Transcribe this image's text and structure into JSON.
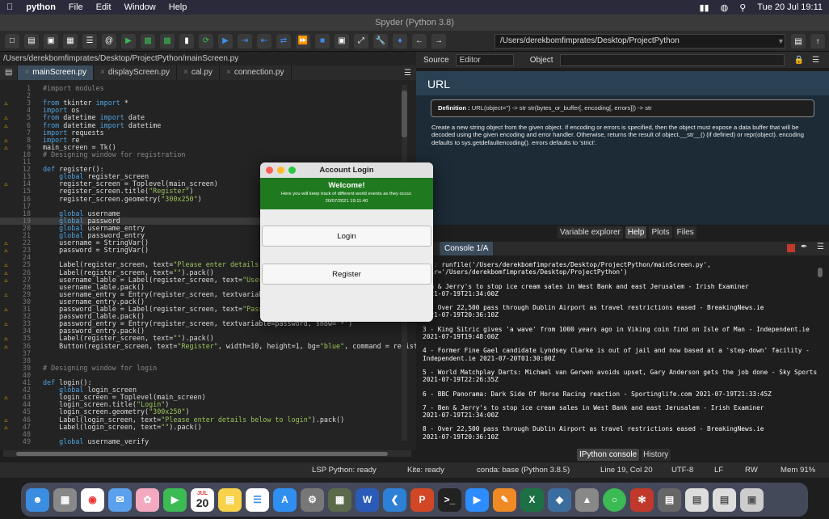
{
  "menubar": {
    "app": "python",
    "items": [
      "File",
      "Edit",
      "Window",
      "Help"
    ],
    "clock": "Tue 20 Jul  19:11"
  },
  "window": {
    "title": "Spyder (Python 3.8)"
  },
  "toolbar": {
    "path": "/Users/derekbomfimprates/Desktop/ProjectPython"
  },
  "editor": {
    "filepath": "/Users/derekbomfimprates/Desktop/ProjectPython/mainScreen.py",
    "tabs": [
      "mainScreen.py",
      "displayScreen.py",
      "cal.py",
      "connection.py"
    ],
    "lines": [
      {
        "n": "1",
        "w": false,
        "t": "#import modules",
        "c": "cm"
      },
      {
        "n": "2",
        "w": false,
        "t": ""
      },
      {
        "n": "3",
        "w": true,
        "t": "from tkinter import *"
      },
      {
        "n": "4",
        "w": false,
        "t": "import os"
      },
      {
        "n": "5",
        "w": true,
        "t": "from datetime import date"
      },
      {
        "n": "6",
        "w": true,
        "t": "from datetime import datetime"
      },
      {
        "n": "7",
        "w": false,
        "t": "import requests"
      },
      {
        "n": "8",
        "w": true,
        "t": "import re"
      },
      {
        "n": "9",
        "w": true,
        "t": "main_screen = Tk()"
      },
      {
        "n": "10",
        "w": false,
        "t": "# Designing window for registration",
        "c": "cm"
      },
      {
        "n": "11",
        "w": false,
        "t": ""
      },
      {
        "n": "12",
        "w": false,
        "t": "def register():"
      },
      {
        "n": "13",
        "w": false,
        "t": "    global register_screen"
      },
      {
        "n": "14",
        "w": true,
        "t": "    register_screen = Toplevel(main_screen)"
      },
      {
        "n": "15",
        "w": false,
        "t": "    register_screen.title(\"Register\")"
      },
      {
        "n": "16",
        "w": false,
        "t": "    register_screen.geometry(\"300x250\")"
      },
      {
        "n": "17",
        "w": false,
        "t": ""
      },
      {
        "n": "18",
        "w": false,
        "t": "    global username"
      },
      {
        "n": "19",
        "w": false,
        "t": "    global password",
        "cur": true
      },
      {
        "n": "20",
        "w": false,
        "t": "    global username_entry"
      },
      {
        "n": "21",
        "w": false,
        "t": "    global password_entry"
      },
      {
        "n": "22",
        "w": true,
        "t": "    username = StringVar()"
      },
      {
        "n": "23",
        "w": true,
        "t": "    password = StringVar()"
      },
      {
        "n": "24",
        "w": false,
        "t": ""
      },
      {
        "n": "25",
        "w": true,
        "t": "    Label(register_screen, text=\"Please enter details bel"
      },
      {
        "n": "26",
        "w": true,
        "t": "    Label(register_screen, text=\"\").pack()"
      },
      {
        "n": "27",
        "w": true,
        "t": "    username_lable = Label(register_screen, text=\"Usernam"
      },
      {
        "n": "28",
        "w": false,
        "t": "    username_lable.pack()"
      },
      {
        "n": "29",
        "w": true,
        "t": "    username_entry = Entry(register_screen, textvariable="
      },
      {
        "n": "30",
        "w": false,
        "t": "    username_entry.pack()"
      },
      {
        "n": "31",
        "w": true,
        "t": "    password_lable = Label(register_screen, text=\"Passwor"
      },
      {
        "n": "32",
        "w": false,
        "t": "    password_lable.pack()"
      },
      {
        "n": "33",
        "w": true,
        "t": "    password_entry = Entry(register_screen, textvariable=password, show='*')"
      },
      {
        "n": "34",
        "w": false,
        "t": "    password_entry.pack()"
      },
      {
        "n": "35",
        "w": true,
        "t": "    Label(register_screen, text=\"\").pack()"
      },
      {
        "n": "36",
        "w": true,
        "t": "    Button(register_screen, text=\"Register\", width=10, height=1, bg=\"blue\", command = registe"
      },
      {
        "n": "37",
        "w": false,
        "t": ""
      },
      {
        "n": "38",
        "w": false,
        "t": ""
      },
      {
        "n": "39",
        "w": false,
        "t": "# Designing window for login",
        "c": "cm"
      },
      {
        "n": "40",
        "w": false,
        "t": ""
      },
      {
        "n": "41",
        "w": false,
        "t": "def login():"
      },
      {
        "n": "42",
        "w": false,
        "t": "    global login_screen"
      },
      {
        "n": "43",
        "w": true,
        "t": "    login_screen = Toplevel(main_screen)"
      },
      {
        "n": "44",
        "w": false,
        "t": "    login_screen.title(\"Login\")"
      },
      {
        "n": "45",
        "w": false,
        "t": "    login_screen.geometry(\"300x250\")"
      },
      {
        "n": "46",
        "w": true,
        "t": "    Label(login_screen, text=\"Please enter details below to login\").pack()"
      },
      {
        "n": "47",
        "w": true,
        "t": "    Label(login_screen, text=\"\").pack()"
      },
      {
        "n": "48",
        "w": false,
        "t": ""
      },
      {
        "n": "49",
        "w": false,
        "t": "    global username_verify"
      }
    ]
  },
  "right_panel": {
    "source_label": "Source",
    "source_value": "Editor",
    "object_label": "Object",
    "help_title": "URL",
    "definition_label": "Definition :",
    "definition": "URL(object='') -> str str(bytes_or_buffer[, encoding[, errors]]) -> str",
    "help_text": "Create a new string object from the given object. If encoding or errors is specified, then the object must expose a data buffer that will be decoded using the given encoding and error handler. Otherwise, returns the result of object.__str__() (if defined) or repr(object). encoding defaults to sys.getdefaultencoding(). errors defaults to 'strict'.",
    "tabs": [
      "Variable explorer",
      "Help",
      "Plots",
      "Files"
    ]
  },
  "console": {
    "tab": "Console 1/A",
    "input_prompt": "[7]:",
    "input": "runfile('/Users/derekbomfimprates/Desktop/ProjectPython/mainScreen.py', wdir='/Users/derekbomfimprates/Desktop/ProjectPython')",
    "entries": [
      "Ben & Jerry's to stop ice cream sales in West Bank and east Jerusalem - Irish Examiner\n2021-07-19T21:34:00Z",
      "2 - Over 22,500 pass through Dublin Airport as travel restrictions eased - BreakingNews.ie\n2021-07-19T20:36:10Z",
      "3 - King Sitric gives 'a wave' from 1000 years ago in Viking coin find on Isle of Man - Independent.ie\n2021-07-19T19:48:00Z",
      "4 - Former Fine Gael candidate Lyndsey Clarke is out of jail and now based at a 'step-down' facility - Independent.ie 2021-07-20T01:30:00Z",
      "5 - World Matchplay Darts: Michael van Gerwen avoids upset, Gary Anderson gets the job done - Sky Sports\n2021-07-19T22:26:35Z",
      "6 - BBC Panorama: Dark Side Of Horse Racing reaction - Sportinglife.com 2021-07-19T21:33:45Z",
      "7 - Ben & Jerry's to stop ice cream sales in West Bank and east Jerusalem - Irish Examiner\n2021-07-19T21:34:00Z",
      "8 - Over 22,500 pass through Dublin Airport as travel restrictions eased - BreakingNews.ie\n2021-07-19T20:36:10Z"
    ],
    "bottom_tabs": [
      "IPython console",
      "History"
    ]
  },
  "statusbar": {
    "lsp": "LSP Python: ready",
    "kite": "Kite: ready",
    "conda": "conda: base (Python 3.8.5)",
    "position": "Line 19, Col 20",
    "encoding": "UTF-8",
    "eol": "LF",
    "rw": "RW",
    "mem": "Mem 91%"
  },
  "dialog": {
    "title": "Account Login",
    "welcome": "Welcome!",
    "subtitle": "Here you will keep track of different world events as they occur.",
    "date": "20/07/2021 19:11:40",
    "login_label": "Login",
    "register_label": "Register",
    "banner_color": "#1f7a1f"
  },
  "dock": {
    "calendar_month": "JUL",
    "calendar_day": "20"
  }
}
